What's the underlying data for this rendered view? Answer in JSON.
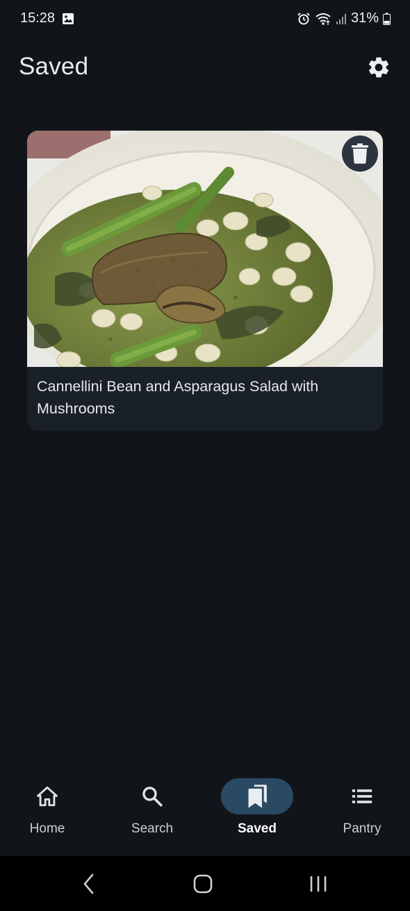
{
  "status_bar": {
    "time": "15:28",
    "battery_percent": "31%",
    "icons": [
      "gallery-notification-icon",
      "alarm-icon",
      "wifi-icon",
      "cell-signal-icon",
      "battery-icon"
    ]
  },
  "header": {
    "title": "Saved",
    "settings_icon": "gear-icon"
  },
  "saved_recipes": [
    {
      "title": "Cannellini Bean and Asparagus Salad with Mushrooms",
      "delete_icon": "trash-icon"
    }
  ],
  "bottom_nav": {
    "items": [
      {
        "label": "Home",
        "icon": "home-icon",
        "active": false
      },
      {
        "label": "Search",
        "icon": "search-icon",
        "active": false
      },
      {
        "label": "Saved",
        "icon": "bookmarks-icon",
        "active": true
      },
      {
        "label": "Pantry",
        "icon": "list-icon",
        "active": false
      }
    ]
  },
  "system_nav": {
    "buttons": [
      "back-icon",
      "home-circle-icon",
      "recents-icon"
    ]
  },
  "colors": {
    "background": "#11151a",
    "card": "#1a2028",
    "active_pill": "#2a4a63",
    "delete_button": "#2d3440"
  }
}
